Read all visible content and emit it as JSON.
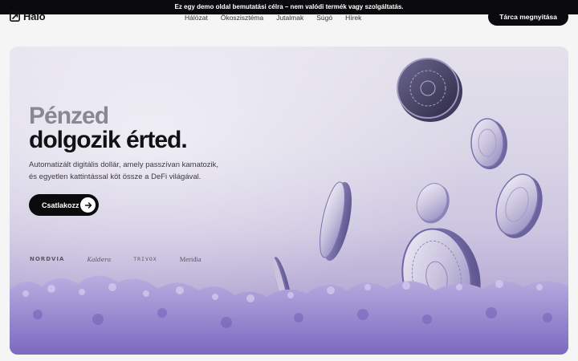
{
  "banner": {
    "text": "Ez egy demo oldal bemutatási célra – nem valódi termék vagy szolgáltatás."
  },
  "brand": {
    "name": "Halo",
    "logo_icon": "halo-logo-icon"
  },
  "nav": {
    "items": [
      {
        "label": "Hálózat"
      },
      {
        "label": "Ökoszisztéma"
      },
      {
        "label": "Jutalmak"
      },
      {
        "label": "Súgó"
      },
      {
        "label": "Hírek"
      }
    ]
  },
  "header": {
    "wallet_button": "Tárca megnyitása"
  },
  "hero": {
    "title_line1": "Pénzed",
    "title_line2": "dolgozik érted.",
    "description": "Automatizált digitális dollár, amely passzívan kamatozik, és egyetlen kattintással köt össze a DeFi világával.",
    "cta_label": "Csatlakozz",
    "cta_icon": "arrow-right-icon"
  },
  "partners": [
    {
      "name": "NORDVIA"
    },
    {
      "name": "Kaldera"
    },
    {
      "name": "TRIVOX"
    },
    {
      "name": "Meridia"
    }
  ],
  "colors": {
    "accent": "#0b0b0d",
    "coin": "#8f86bd",
    "flowers": "#9a86d0"
  }
}
